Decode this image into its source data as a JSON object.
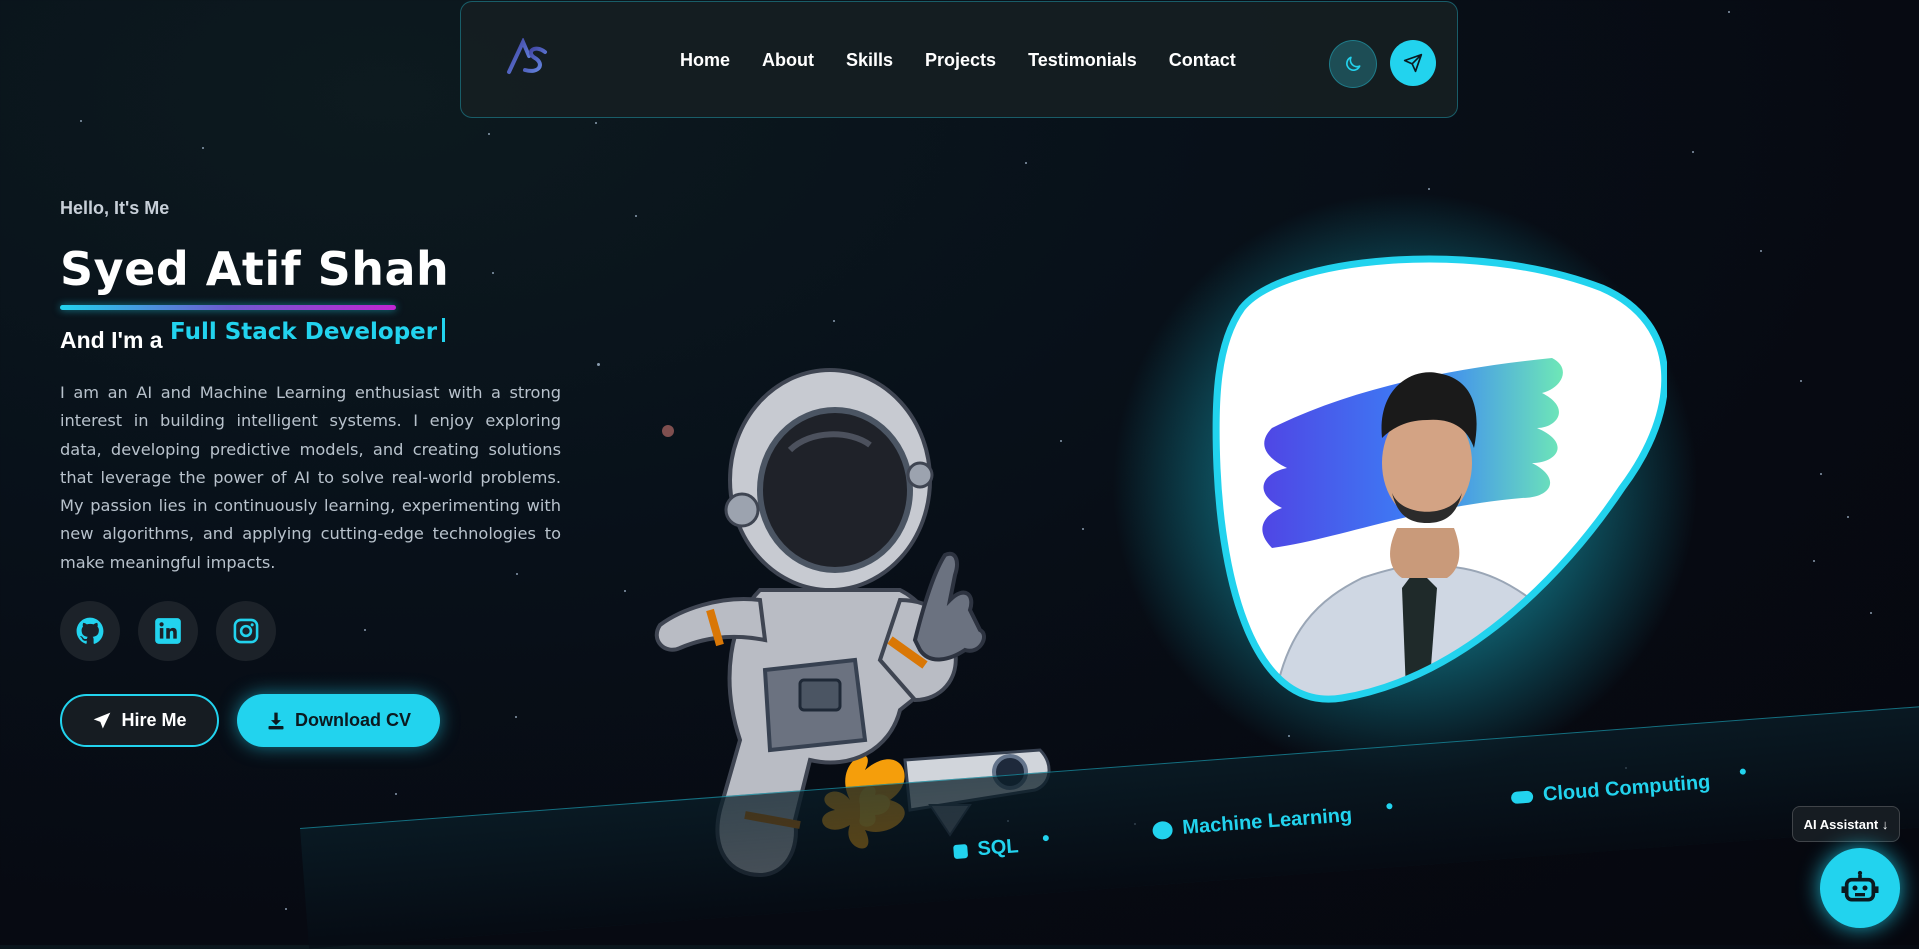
{
  "nav": {
    "logo_text": "AS",
    "links": [
      "Home",
      "About",
      "Skills",
      "Projects",
      "Testimonials",
      "Contact"
    ]
  },
  "hero": {
    "greeting": "Hello, It's Me",
    "name": "Syed Atif Shah",
    "role_prefix": "And I'm a",
    "role_typed": "Full Stack Developer",
    "bio": "I am an AI and Machine Learning enthusiast with a strong interest in building intelligent systems. I enjoy exploring data, developing predictive models, and creating solutions that leverage the power of AI to solve real-world problems. My passion lies in continuously learning, experimenting with new algorithms, and applying cutting-edge technologies to make meaningful impacts.",
    "hire_label": "Hire Me",
    "cv_label": "Download CV"
  },
  "socials": [
    "github-icon",
    "linkedin-icon",
    "instagram-icon"
  ],
  "marquee": {
    "items": [
      "SQL",
      "Machine Learning",
      "Cloud Computing"
    ]
  },
  "ai": {
    "tooltip": "AI Assistant ↓"
  },
  "colors": {
    "accent": "#22d3ee",
    "background": "#070a12",
    "nav_bg": "#161e22"
  }
}
